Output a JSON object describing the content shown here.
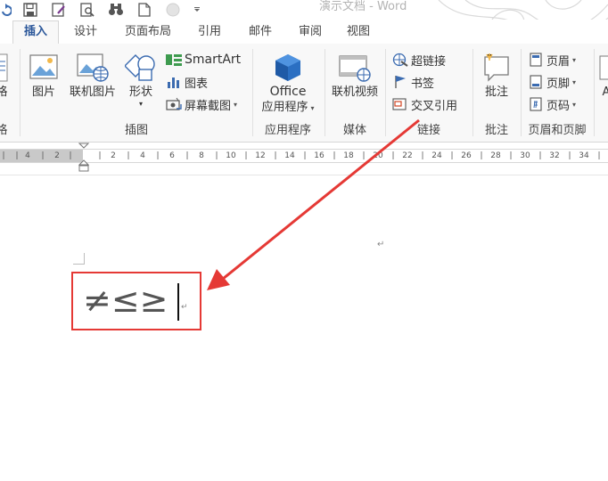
{
  "title_bar": {
    "doc_title": "演示文档 - Word"
  },
  "tabs": [
    {
      "label": "插入",
      "active": true
    },
    {
      "label": "设计"
    },
    {
      "label": "页面布局"
    },
    {
      "label": "引用"
    },
    {
      "label": "邮件"
    },
    {
      "label": "审阅"
    },
    {
      "label": "视图"
    }
  ],
  "ribbon": {
    "pages_partial": {
      "label": "格",
      "group": "格"
    },
    "illustrations": {
      "picture": "图片",
      "online_picture": "联机图片",
      "shapes": "形状",
      "smartart": "SmartArt",
      "chart": "图表",
      "screenshot": "屏幕截图",
      "group": "插图"
    },
    "apps": {
      "line1": "Office",
      "line2": "应用程序",
      "group": "应用程序"
    },
    "media": {
      "online_video": "联机视频",
      "group": "媒体"
    },
    "links": {
      "hyperlink": "超链接",
      "bookmark": "书签",
      "cross_reference": "交叉引用",
      "group": "链接"
    },
    "comments": {
      "comment": "批注",
      "group": "批注"
    },
    "header_footer": {
      "header": "页眉",
      "footer": "页脚",
      "page_number": "页码",
      "group": "页眉和页脚"
    },
    "text_partial": {
      "label": "A"
    }
  },
  "ruler": {
    "left_labels": [
      "4",
      "2"
    ],
    "labels": [
      "2",
      "4",
      "6",
      "8",
      "10",
      "12",
      "14",
      "16",
      "18",
      "20",
      "22",
      "24",
      "26",
      "28",
      "30",
      "32",
      "34"
    ]
  },
  "document": {
    "text": "≠≤≥"
  },
  "colors": {
    "accent": "#2b579a",
    "annotation_red": "#e53935",
    "office_orange": "#d24726"
  }
}
